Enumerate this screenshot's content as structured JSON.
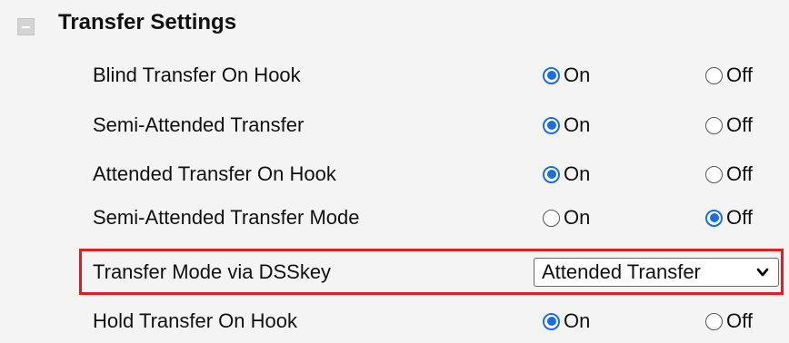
{
  "section": {
    "title": "Transfer Settings",
    "collapse_icon": "collapse-minus-icon"
  },
  "rows": [
    {
      "label": "Blind Transfer On Hook",
      "on_label": "On",
      "off_label": "Off",
      "selected": "On"
    },
    {
      "label": "Semi-Attended Transfer",
      "on_label": "On",
      "off_label": "Off",
      "selected": "On"
    },
    {
      "label": "Attended Transfer On Hook",
      "on_label": "On",
      "off_label": "Off",
      "selected": "On"
    },
    {
      "label": "Semi-Attended Transfer Mode",
      "on_label": "On",
      "off_label": "Off",
      "selected": "Off"
    }
  ],
  "dsskey_row": {
    "label": "Transfer Mode via DSSkey",
    "selected_value": "Attended Transfer",
    "highlight_color": "#dc1f26"
  },
  "hold_row": {
    "label": "Hold Transfer On Hook",
    "on_label": "On",
    "off_label": "Off",
    "selected": "On"
  },
  "colors": {
    "accent": "#1a6fe0",
    "background": "#f4f4f4"
  }
}
